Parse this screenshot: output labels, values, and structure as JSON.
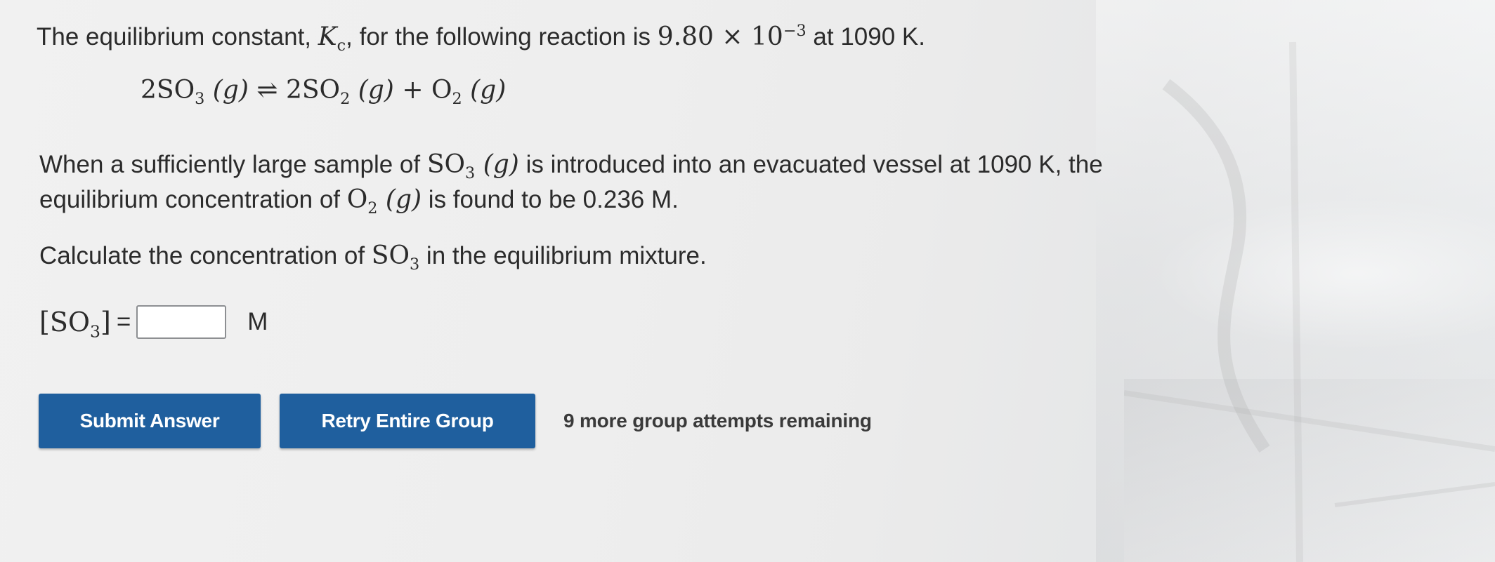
{
  "problem": {
    "intro_start": "The equilibrium constant, ",
    "kc_symbol": "K",
    "kc_sub": "c",
    "intro_mid": ", for the following reaction is ",
    "kc_mantissa": "9.80",
    "times_sign": "×",
    "kc_base": "10",
    "kc_exponent": "−3",
    "intro_end": " at 1090 K.",
    "equation": {
      "reactant_coef": "2SO",
      "reactant_sub": "3",
      "reactant_phase": "(g)",
      "arrow": "⇌",
      "product1_coef": "2SO",
      "product1_sub": "2",
      "product1_phase": "(g)",
      "plus": "+",
      "product2": "O",
      "product2_sub": "2",
      "product2_phase": "(g)"
    },
    "para_start": "When a sufficiently large sample of ",
    "para_species": "SO",
    "para_species_sub": "3",
    "para_species_phase": "(g)",
    "para_mid": " is introduced into an evacuated vessel at 1090 K, the equilibrium concentration of ",
    "para_o2": "O",
    "para_o2_sub": "2",
    "para_o2_phase": "(g)",
    "para_end": " is found to be 0.236 M.",
    "question_start": "Calculate the concentration of ",
    "question_species": "SO",
    "question_species_sub": "3",
    "question_end": " in the equilibrium mixture."
  },
  "answer": {
    "label_open": "[SO",
    "label_sub": "3",
    "label_close": "]",
    "equals": "=",
    "value": "",
    "unit": "M"
  },
  "actions": {
    "submit_label": "Submit Answer",
    "retry_label": "Retry Entire Group",
    "attempts_text": "9 more group attempts remaining"
  },
  "colors": {
    "button_bg": "#1f5f9e",
    "button_text": "#ffffff",
    "text": "#2b2b2b"
  }
}
